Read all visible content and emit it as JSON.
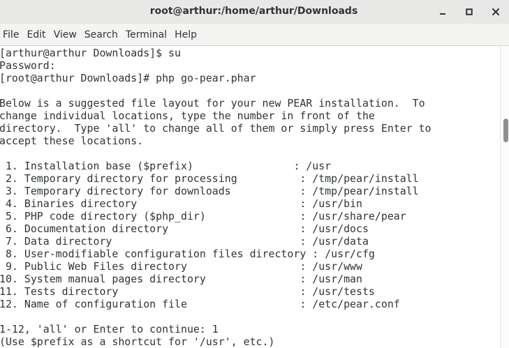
{
  "window": {
    "title": "root@arthur:/home/arthur/Downloads"
  },
  "controls": {
    "minimize_icon": "minimize-icon",
    "maximize_icon": "maximize-icon",
    "close_icon": "close-icon"
  },
  "menu": {
    "items": [
      "File",
      "Edit",
      "View",
      "Search",
      "Terminal",
      "Help"
    ]
  },
  "terminal": {
    "lines": [
      "[arthur@arthur Downloads]$ su",
      "Password:",
      "[root@arthur Downloads]# php go-pear.phar",
      "",
      "Below is a suggested file layout for your new PEAR installation.  To",
      "change individual locations, type the number in front of the",
      "directory.  Type 'all' to change all of them or simply press Enter to",
      "accept these locations.",
      "",
      " 1. Installation base ($prefix)                : /usr",
      " 2. Temporary directory for processing          : /tmp/pear/install",
      " 3. Temporary directory for downloads           : /tmp/pear/install",
      " 4. Binaries directory                          : /usr/bin",
      " 5. PHP code directory ($php_dir)               : /usr/share/pear",
      " 6. Documentation directory                     : /usr/docs",
      " 7. Data directory                              : /usr/data",
      " 8. User-modifiable configuration files directory : /usr/cfg",
      " 9. Public Web Files directory                  : /usr/www",
      "10. System manual pages directory               : /usr/man",
      "11. Tests directory                             : /usr/tests",
      "12. Name of configuration file                  : /etc/pear.conf",
      "",
      "1-12, 'all' or Enter to continue: 1",
      "(Use $prefix as a shortcut for '/usr', etc.)"
    ]
  },
  "scrollbar": {
    "position_fraction": 0.26
  }
}
